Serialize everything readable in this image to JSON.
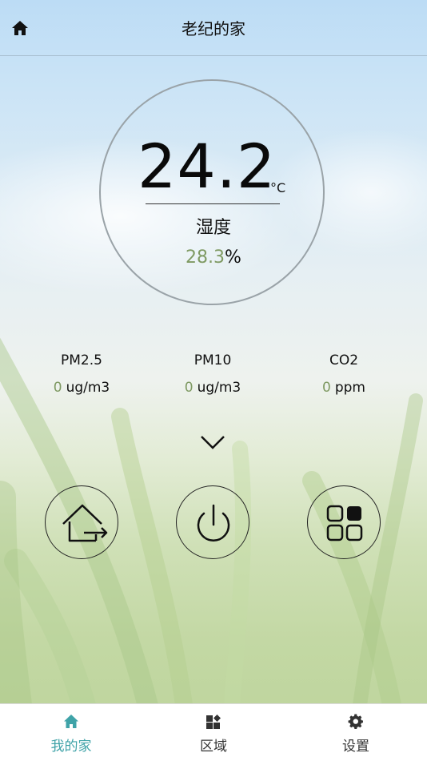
{
  "header": {
    "title": "老纪的家",
    "home_icon": "home-icon"
  },
  "climate": {
    "temperature": "24.2",
    "temperature_unit": "°C",
    "humidity_label": "湿度",
    "humidity_value": "28.3",
    "humidity_unit": "%"
  },
  "sensors": [
    {
      "name": "PM2.5",
      "value": "0",
      "unit": "ug/m3"
    },
    {
      "name": "PM10",
      "value": "0",
      "unit": "ug/m3"
    },
    {
      "name": "CO2",
      "value": "0",
      "unit": "ppm"
    }
  ],
  "actions": [
    {
      "icon": "leave-home-icon"
    },
    {
      "icon": "power-icon"
    },
    {
      "icon": "apps-grid-icon"
    }
  ],
  "tabbar": {
    "items": [
      {
        "label": "我的家",
        "icon": "home-icon",
        "active": true
      },
      {
        "label": "区域",
        "icon": "area-icon",
        "active": false
      },
      {
        "label": "设置",
        "icon": "gear-icon",
        "active": false
      }
    ]
  },
  "colors": {
    "accent": "#3fa3a8",
    "value_green": "#7f9a63"
  }
}
